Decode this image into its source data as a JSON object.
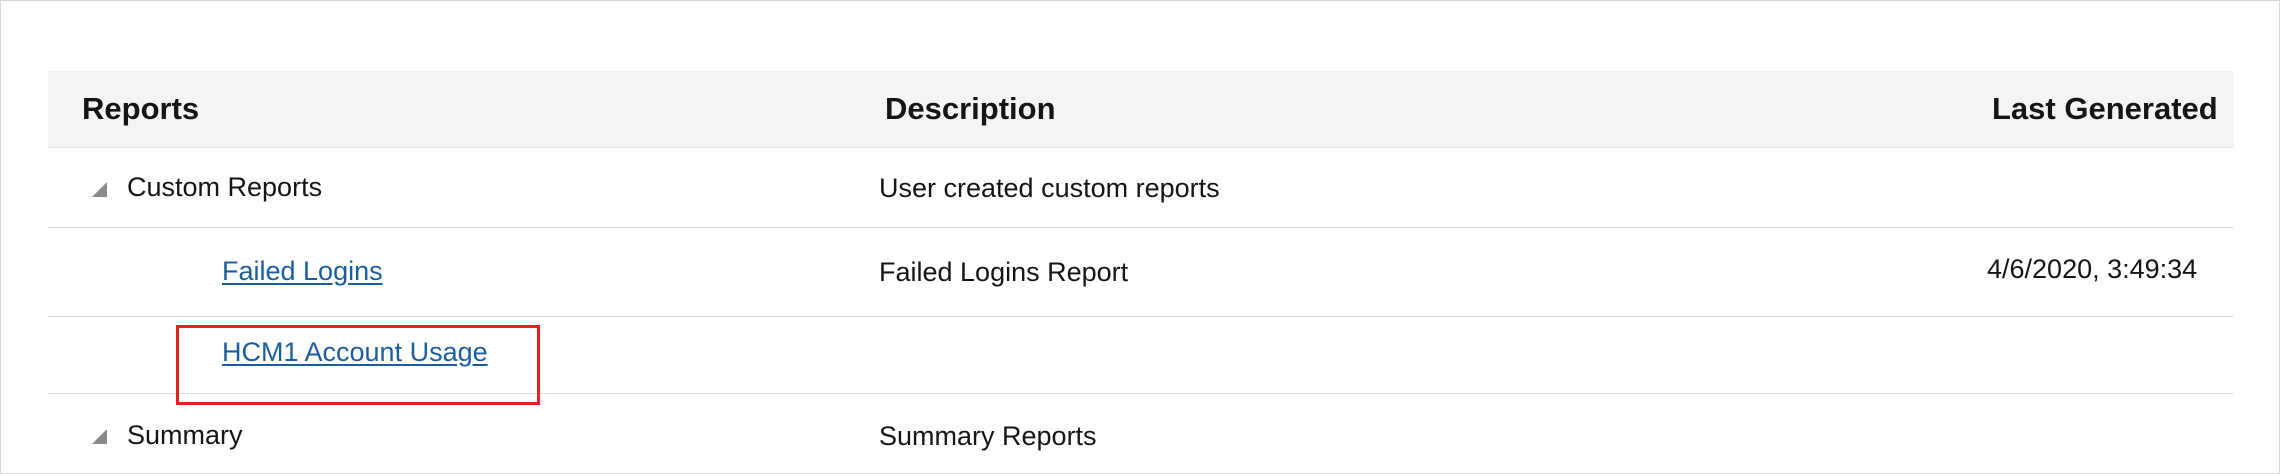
{
  "table": {
    "columns": {
      "reports": "Reports",
      "description": "Description",
      "last_generated": "Last Generated"
    },
    "rows": [
      {
        "name": "Custom Reports",
        "description": "User created custom reports",
        "last_generated": "",
        "type": "group",
        "expanded": true
      },
      {
        "name": "Failed Logins",
        "description": "Failed Logins Report",
        "last_generated": "4/6/2020, 3:49:34",
        "type": "report"
      },
      {
        "name": "HCM1 Account Usage",
        "description": "",
        "last_generated": "",
        "type": "report",
        "highlighted": true
      },
      {
        "name": "Summary",
        "description": "Summary Reports",
        "last_generated": "",
        "type": "group",
        "expanded": true
      }
    ]
  },
  "colors": {
    "header_bg": "#f4f4f4",
    "link": "#1a5e9f",
    "highlight_border": "#e0231e",
    "text": "#161513"
  },
  "icons": {
    "expand_toggle": "triangle-down-right-icon"
  }
}
